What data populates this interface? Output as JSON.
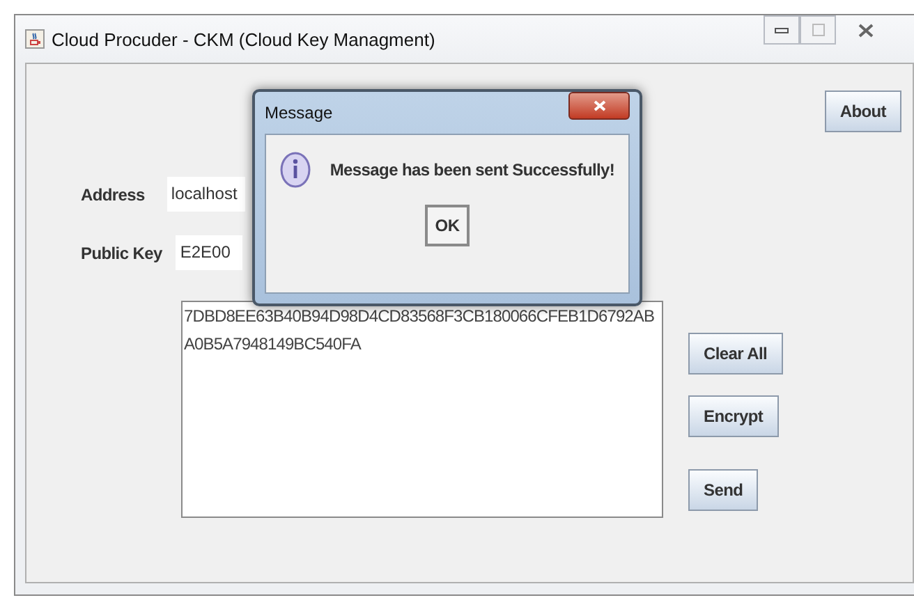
{
  "window": {
    "title": "Cloud Procuder - CKM (Cloud Key Managment)"
  },
  "about_button": "About",
  "fields": [
    {
      "label": "Address",
      "value": "localhost"
    },
    {
      "label": "Public Key",
      "value": "E2E00"
    }
  ],
  "text_area": {
    "value": "7DBD8EE63B40B94D98D4CD83568F3CB180066CFEB1D6792ABA0B5A7948149BC540FA"
  },
  "buttons": [
    "Clear All",
    "Encrypt",
    "Send"
  ],
  "dialog": {
    "title": "Message",
    "message": "Message has been sent Successfully!",
    "ok": "OK"
  }
}
